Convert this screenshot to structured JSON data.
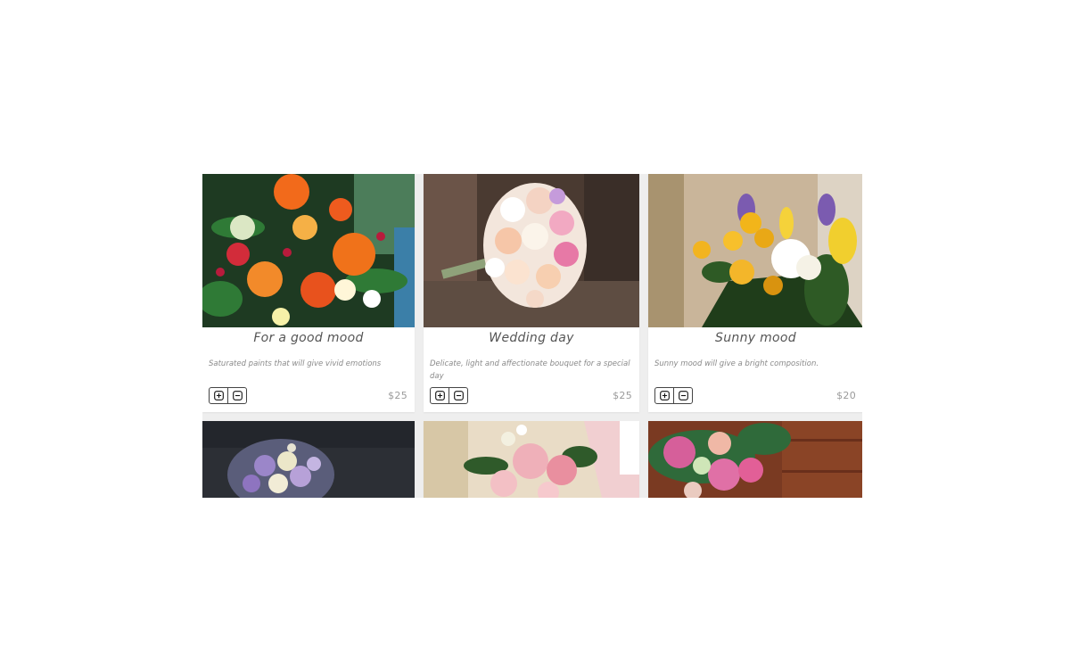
{
  "products": [
    {
      "title": "For a good mood",
      "description": "Saturated paints that will give vivid emotions",
      "price": "$25",
      "image": "bouquet-orange-gerbera"
    },
    {
      "title": "Wedding day",
      "description": "Delicate, light and affectionate bouquet for a special day",
      "price": "$25",
      "image": "bouquet-wedding-roses"
    },
    {
      "title": "Sunny mood",
      "description": "Sunny mood will give a bright composition.",
      "price": "$20",
      "image": "bouquet-yellow-tulips"
    }
  ],
  "more_products": [
    {
      "image": "bouquet-lilac"
    },
    {
      "image": "bouquet-pink-roses"
    },
    {
      "image": "bouquet-pink-gerbera"
    }
  ],
  "icons": {
    "increase": "plus-square-icon",
    "decrease": "minus-square-icon"
  },
  "colors": {
    "page": "#ffffff",
    "grid_bg": "#eeeeee",
    "card": "#ffffff",
    "title": "#555555",
    "muted": "#8a8a8a",
    "price": "#9a9a9a"
  }
}
